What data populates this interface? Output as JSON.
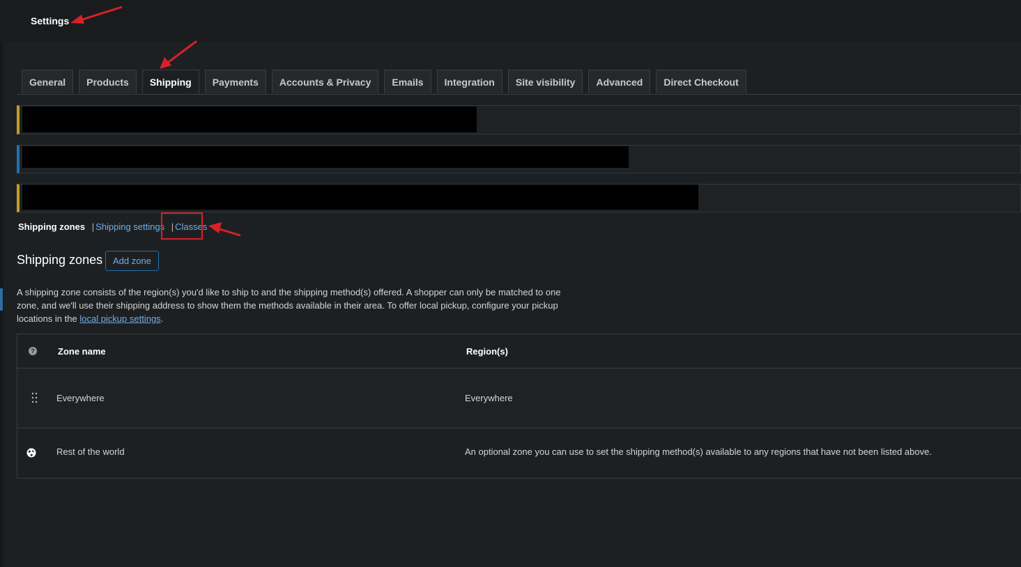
{
  "page": {
    "title": "Settings"
  },
  "tabs": [
    {
      "label": "General",
      "active": false
    },
    {
      "label": "Products",
      "active": false
    },
    {
      "label": "Shipping",
      "active": true
    },
    {
      "label": "Payments",
      "active": false
    },
    {
      "label": "Accounts & Privacy",
      "active": false
    },
    {
      "label": "Emails",
      "active": false
    },
    {
      "label": "Integration",
      "active": false
    },
    {
      "label": "Site visibility",
      "active": false
    },
    {
      "label": "Advanced",
      "active": false
    },
    {
      "label": "Direct Checkout",
      "active": false
    }
  ],
  "subnav": {
    "current": "Shipping zones",
    "separator": "|",
    "links": [
      "Shipping settings",
      "Classes"
    ]
  },
  "section": {
    "title": "Shipping zones",
    "add_button": "Add zone",
    "description_text": "A shipping zone consists of the region(s) you'd like to ship to and the shipping method(s) offered. A shopper can only be matched to one zone, and we'll use their shipping address to show them the methods available in their area. To offer local pickup, configure your pickup locations in the ",
    "description_link": "local pickup settings",
    "description_end": "."
  },
  "table": {
    "headers": {
      "help": "?",
      "zone_name": "Zone name",
      "regions": "Region(s)"
    },
    "rows": [
      {
        "zone": "Everywhere",
        "regions": "Everywhere"
      },
      {
        "zone": "Rest of the world",
        "regions": "An optional zone you can use to set the shipping method(s) available to any regions that have not been listed above."
      }
    ]
  },
  "colors": {
    "background": "#1d2022",
    "link": "#72aee6",
    "notice_warning": "#c39d28",
    "notice_info": "#2271b1",
    "annotation": "#d9202a"
  },
  "icons": [
    "help-icon",
    "drag-handle-icon",
    "globe-icon",
    "annotation-arrow-icon"
  ]
}
